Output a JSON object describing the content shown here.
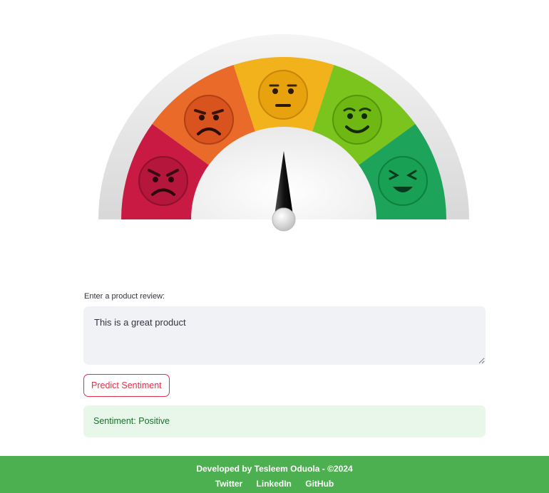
{
  "gauge": {
    "segments": [
      {
        "mood": "angry",
        "color": "#c91a44"
      },
      {
        "mood": "sad",
        "color": "#ea6a2a"
      },
      {
        "mood": "neutral",
        "color": "#f1b21c"
      },
      {
        "mood": "happy",
        "color": "#7bc41d"
      },
      {
        "mood": "very-happy",
        "color": "#1ea35a"
      }
    ],
    "needle_sentiment": "neutral"
  },
  "form": {
    "review_label": "Enter a product review:",
    "review_value": "This is a great product",
    "predict_label": "Predict Sentiment"
  },
  "result": {
    "text": "Sentiment: Positive"
  },
  "footer": {
    "credit": "Developed by Tesleem Oduola - ©2024",
    "links": [
      "Twitter",
      "LinkedIn",
      "GitHub"
    ]
  },
  "colors": {
    "accent": "#e0304a",
    "footer_bg": "#4caf50",
    "success_bg": "#e8f7ea",
    "success_text": "#1d6d2d"
  }
}
